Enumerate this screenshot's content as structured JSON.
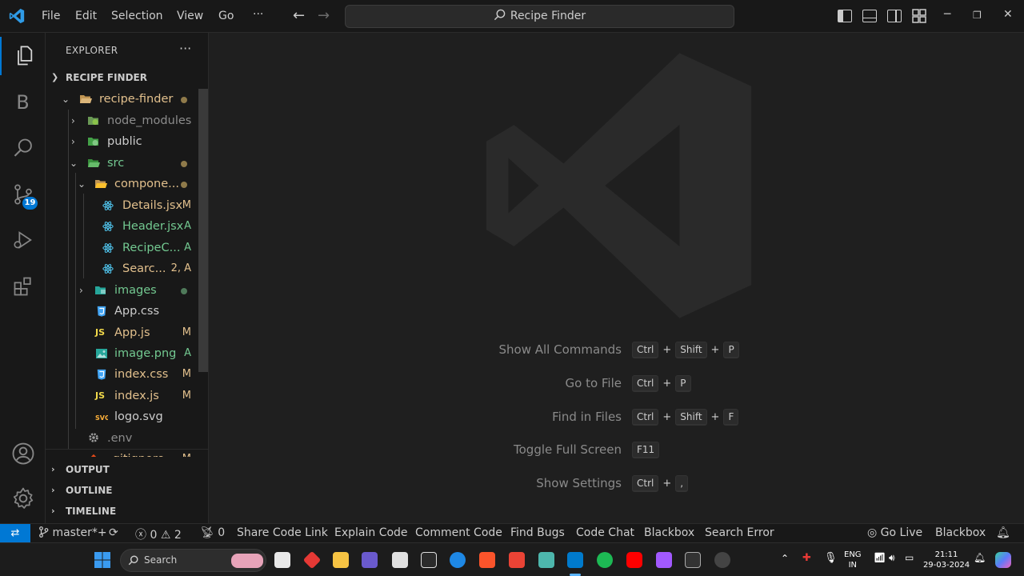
{
  "menu": {
    "file": "File",
    "edit": "Edit",
    "selection": "Selection",
    "view": "View",
    "go": "Go",
    "more": "···"
  },
  "command_center": {
    "label": "Recipe Finder"
  },
  "activity": {
    "source_control_badge": "19",
    "blackbox_letter": "B"
  },
  "sidebar": {
    "title": "EXPLORER",
    "more": "···",
    "root": "RECIPE FINDER",
    "items": [
      {
        "name": "recipe-finder",
        "status": ""
      },
      {
        "name": "node_modules",
        "status": ""
      },
      {
        "name": "public",
        "status": ""
      },
      {
        "name": "src",
        "status": ""
      },
      {
        "name": "compone...",
        "status": ""
      },
      {
        "name": "Details.jsx",
        "status": "M"
      },
      {
        "name": "Header.jsx",
        "status": "A"
      },
      {
        "name": "RecipeC...",
        "status": "A"
      },
      {
        "name": "Searc...",
        "status": "2, A"
      },
      {
        "name": "images",
        "status": ""
      },
      {
        "name": "App.css",
        "status": ""
      },
      {
        "name": "App.js",
        "status": "M"
      },
      {
        "name": "image.png",
        "status": "A"
      },
      {
        "name": "index.css",
        "status": "M"
      },
      {
        "name": "index.js",
        "status": "M"
      },
      {
        "name": "logo.svg",
        "status": ""
      },
      {
        "name": ".env",
        "status": ""
      },
      {
        "name": ".gitignore",
        "status": "M"
      }
    ],
    "icon_text": {
      "js": "JS"
    },
    "sections": {
      "output": "OUTPUT",
      "outline": "OUTLINE",
      "timeline": "TIMELINE"
    }
  },
  "shortcuts": [
    {
      "label": "Show All Commands",
      "keys": [
        "Ctrl",
        "Shift",
        "P"
      ]
    },
    {
      "label": "Go to File",
      "keys": [
        "Ctrl",
        "P"
      ]
    },
    {
      "label": "Find in Files",
      "keys": [
        "Ctrl",
        "Shift",
        "F"
      ]
    },
    {
      "label": "Toggle Full Screen",
      "keys": [
        "F11"
      ]
    },
    {
      "label": "Show Settings",
      "keys": [
        "Ctrl",
        ","
      ]
    }
  ],
  "statusbar": {
    "remote": "⇄",
    "branch": "master*+",
    "errors": "0",
    "warnings": "2",
    "ports": "0",
    "items": [
      "Share Code Link",
      "Explain Code",
      "Comment Code",
      "Find Bugs",
      "Code Chat",
      "Blackbox",
      "Search Error"
    ],
    "go_live": "Go Live",
    "blackbox_right": "Blackbox"
  },
  "taskbar": {
    "search_label": "Search",
    "lang": "ENG",
    "region": "IN",
    "time": "21:11",
    "date": "29-03-2024"
  },
  "colors": {
    "accent": "#0078d4",
    "modified": "#e2c08d",
    "added": "#73c991",
    "folder": "#dcb67a",
    "react": "#4fc1e9"
  }
}
